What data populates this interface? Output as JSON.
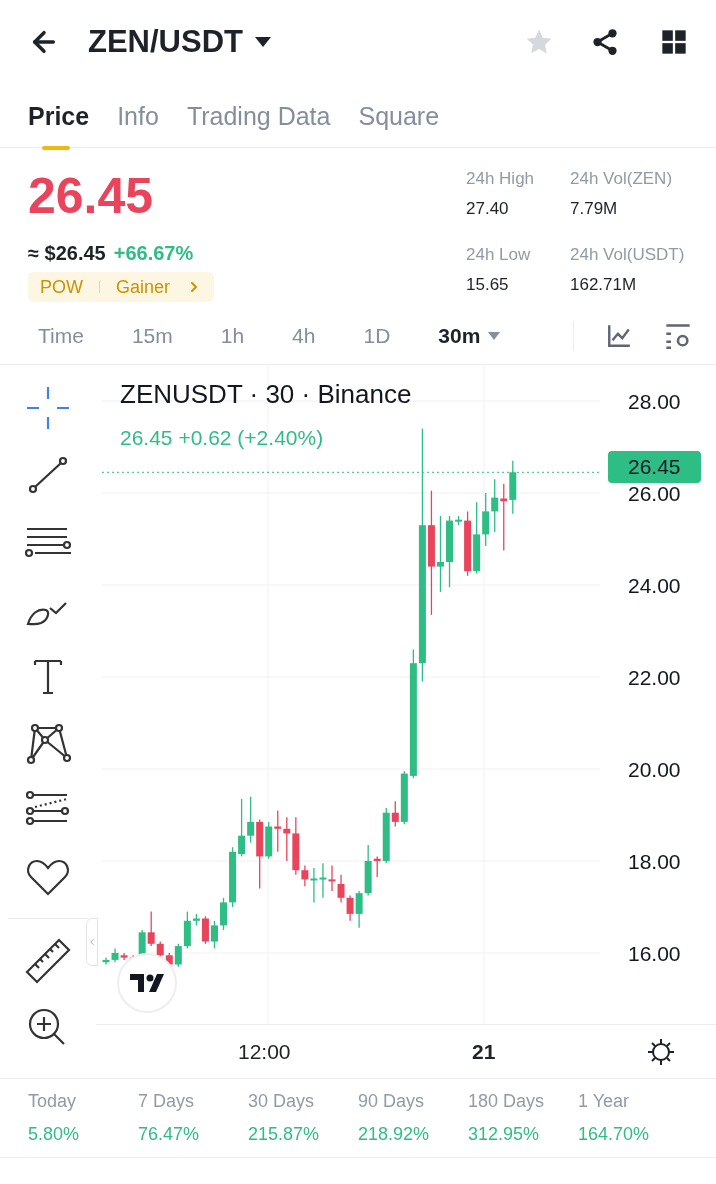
{
  "header": {
    "pair": "ZEN/USDT",
    "favorite": false
  },
  "tabs": [
    {
      "label": "Price",
      "selected": true
    },
    {
      "label": "Info",
      "selected": false
    },
    {
      "label": "Trading Data",
      "selected": false
    },
    {
      "label": "Square",
      "selected": false
    }
  ],
  "price": {
    "last": "26.45",
    "usd": "≈ $26.45",
    "change": "+66.67%",
    "tags": [
      "POW",
      "Gainer"
    ]
  },
  "stats": [
    {
      "label": "24h High",
      "value": "27.40"
    },
    {
      "label": "24h Vol(ZEN)",
      "value": "7.79M"
    },
    {
      "label": "24h Low",
      "value": "15.65"
    },
    {
      "label": "24h Vol(USDT)",
      "value": "162.71M"
    }
  ],
  "intervals": [
    {
      "label": "Time",
      "selected": false
    },
    {
      "label": "15m",
      "selected": false
    },
    {
      "label": "1h",
      "selected": false
    },
    {
      "label": "4h",
      "selected": false
    },
    {
      "label": "1D",
      "selected": false
    },
    {
      "label": "30m",
      "selected": true
    }
  ],
  "tools": [
    {
      "kind": "crosshair",
      "selected": true
    },
    {
      "kind": "trendline",
      "selected": false
    },
    {
      "kind": "lines",
      "selected": false
    },
    {
      "kind": "brush",
      "selected": false
    },
    {
      "kind": "text",
      "selected": false
    },
    {
      "kind": "pattern",
      "selected": false
    },
    {
      "kind": "fib",
      "selected": false
    },
    {
      "kind": "heart",
      "selected": false
    },
    {
      "kind": "ruler",
      "selected": false
    },
    {
      "kind": "zoom",
      "selected": false
    }
  ],
  "chart": {
    "title": "ZENUSDT · 30 · Binance",
    "legend": "26.45 +0.62 (+2.40%)",
    "last_price": "26.45",
    "y_labels": [
      "28.00",
      "26.00",
      "24.00",
      "22.00",
      "20.00",
      "18.00",
      "16.00"
    ],
    "x_labels": [
      {
        "label": "12:00",
        "bold": false
      },
      {
        "label": "21",
        "bold": true
      }
    ]
  },
  "performance": [
    {
      "label": "Today",
      "value": "5.80%"
    },
    {
      "label": "7 Days",
      "value": "76.47%"
    },
    {
      "label": "30 Days",
      "value": "215.87%"
    },
    {
      "label": "90 Days",
      "value": "218.92%"
    },
    {
      "label": "180 Days",
      "value": "312.95%"
    },
    {
      "label": "1 Year",
      "value": "164.70%"
    }
  ]
}
